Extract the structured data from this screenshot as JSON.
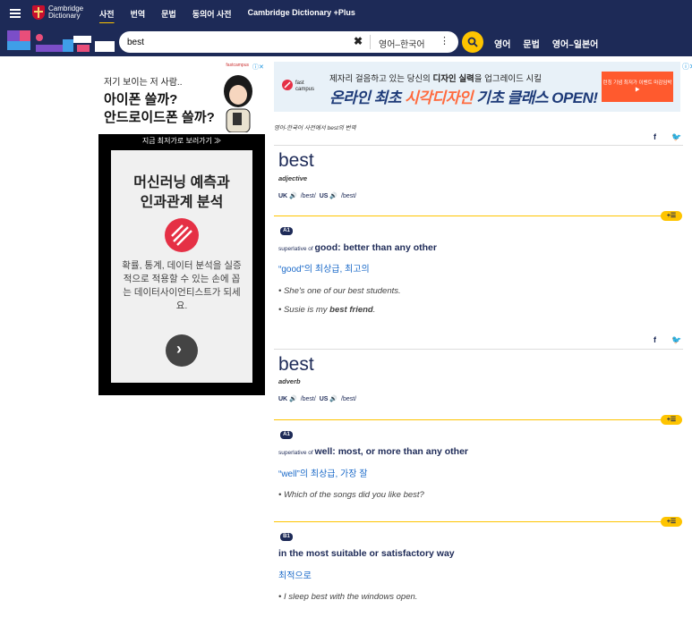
{
  "header": {
    "logo_line1": "Cambridge",
    "logo_line2": "Dictionary",
    "nav": [
      "사전",
      "번역",
      "문법",
      "동의어 사전",
      "Cambridge Dictionary +Plus"
    ]
  },
  "search": {
    "value": "best",
    "clear_label": "✖",
    "language": "영어–한국어",
    "subnav": [
      "영어",
      "문법",
      "영어–일본어"
    ]
  },
  "left_ad": {
    "badge": "fastcampus",
    "line1": "저기 보이는 저 사람..",
    "line2": "아이폰 쓸까?",
    "line3": "안드로이드폰 쓸까?",
    "cta": "지금 최저가로 보러가기 ≫",
    "card_title1": "머신러닝 예측과",
    "card_title2": "인과관계 분석",
    "card_body": "확률, 통계, 데이터 분석을 실증적으로 적용할 수 있는 손에 꼽는 데이터사이언티스트가 되세요.",
    "arrow": "›"
  },
  "banner_ad": {
    "brand": "fast campus",
    "top_pre": "제자리 걸음하고 있는 당신의 ",
    "top_bold": "디자인 실력",
    "top_post": "을 업그레이드 시킬",
    "main_a": "온라인 최초 ",
    "main_hl1": "시각디자인",
    "main_b": " 기초 ",
    "main_c": "클래스 OPEN!",
    "right_text": "런칭 기념 최저가 이벤트 마감임박 ▶"
  },
  "breadcrumb": "영어-한국어 사전에서 best의 번역",
  "share": {
    "facebook": "f",
    "twitter": "🐦"
  },
  "entries": [
    {
      "headword": "best",
      "pos": "adjective",
      "uk_label": "UK",
      "uk_pron": "/best/",
      "us_label": "US",
      "us_pron": "/best/",
      "plus": "+☰",
      "senses": [
        {
          "level": "A1",
          "guide": "superlative of ",
          "definition": "good: better than any other",
          "translation": "“good”의 최상급, 최고의",
          "examples": [
            {
              "text": "• She's one of our best students.",
              "bold": ""
            },
            {
              "text": "• Susie is my ",
              "bold": "best friend",
              "after": "."
            }
          ]
        }
      ]
    },
    {
      "headword": "best",
      "pos": "adverb",
      "uk_label": "UK",
      "uk_pron": "/best/",
      "us_label": "US",
      "us_pron": "/best/",
      "plus": "+☰",
      "senses": [
        {
          "level": "A1",
          "guide": "superlative of ",
          "definition": "well: most, or more than any other",
          "translation": "“well”의 최상급, 가장 잘",
          "examples": [
            {
              "text": "• Which of the songs did you like best?"
            }
          ]
        },
        {
          "level": "B1",
          "guide": "",
          "definition": "in the most suitable or satisfactory way",
          "translation": "최적으로",
          "examples": [
            {
              "text": "• I sleep best with the windows open."
            }
          ]
        }
      ]
    }
  ],
  "colors": {
    "navy": "#1d2a57",
    "accent": "#fec400",
    "link": "#1b6ac9"
  }
}
